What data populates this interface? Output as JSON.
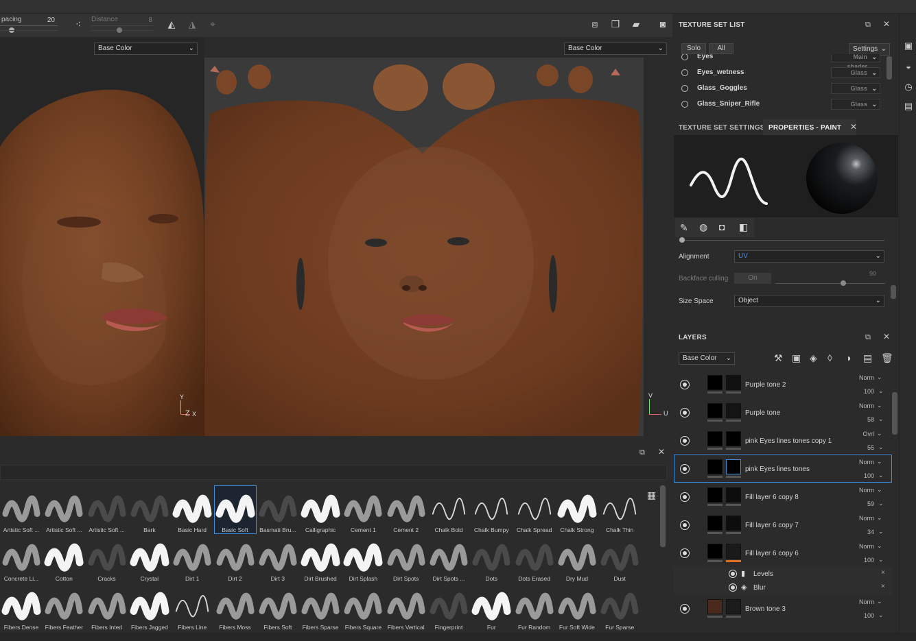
{
  "toolbar": {
    "spacing_label": "pacing",
    "spacing_value": "20",
    "distance_label": "Distance",
    "distance_value": "8",
    "spacing_slider": 0.2,
    "distance_slider": 0.45
  },
  "viewport3d": {
    "channel": "Base Color",
    "axis_y": "Y",
    "axis_z": "Z",
    "axis_x": "X"
  },
  "viewport2d": {
    "channel": "Base Color",
    "axis_v": "V",
    "axis_u": "U"
  },
  "texture_set_list": {
    "title": "TEXTURE SET LIST",
    "solo_label": "Solo",
    "all_label": "All",
    "settings_label": "Settings",
    "items": [
      {
        "name": "Eyes",
        "shader": "Main shader"
      },
      {
        "name": "Eyes_wetness",
        "shader": "Glass"
      },
      {
        "name": "Glass_Goggles",
        "shader": "Glass"
      },
      {
        "name": "Glass_Sniper_Rifle",
        "shader": "Glass"
      }
    ]
  },
  "properties": {
    "tab_settings": "TEXTURE SET SETTINGS",
    "tab_paint": "PROPERTIES - PAINT",
    "alignment_label": "Alignment",
    "alignment_value": "UV",
    "backface_label": "Backface culling",
    "backface_value": "On",
    "backface_number": "90",
    "backface_slider": 0.62,
    "size_space_label": "Size Space",
    "size_space_value": "Object"
  },
  "layers": {
    "title": "LAYERS",
    "channel": "Base Color",
    "rows": [
      {
        "name": "Purple tone 2",
        "blend": "Norm",
        "opacity": "100"
      },
      {
        "name": "Purple tone",
        "blend": "Norm",
        "opacity": "58"
      },
      {
        "name": "pink Eyes lines tones copy 1",
        "blend": "Ovrl",
        "opacity": "55"
      },
      {
        "name": "pink Eyes lines tones",
        "blend": "Norm",
        "opacity": "100"
      },
      {
        "name": "Fill layer 6 copy 8",
        "blend": "Norm",
        "opacity": "59"
      },
      {
        "name": "Fill layer 6 copy 7",
        "blend": "Norm",
        "opacity": "34"
      },
      {
        "name": "Fill layer 6 copy 6",
        "blend": "Norm",
        "opacity": "100"
      }
    ],
    "effects": [
      {
        "name": "Levels"
      },
      {
        "name": "Blur"
      }
    ],
    "last_row": {
      "name": "Brown tone 3",
      "blend": "Norm",
      "opacity": "100"
    }
  },
  "brushes": {
    "rows": [
      [
        "Artistic Soft ...",
        "Artistic Soft ...",
        "Artistic Soft ...",
        "Bark",
        "Basic Hard",
        "Basic Soft",
        "Basmati Bru...",
        "Calligraphic",
        "Cement 1",
        "Cement 2",
        "Chalk Bold",
        "Chalk Bumpy",
        "Chalk Spread",
        "Chalk Strong",
        "Chalk Thin"
      ],
      [
        "Concrete Li...",
        "Cotton",
        "Cracks",
        "Crystal",
        "Dirt 1",
        "Dirt 2",
        "Dirt 3",
        "Dirt Brushed",
        "Dirt Splash",
        "Dirt Spots",
        "Dirt Spots ...",
        "Dots",
        "Dots Erased",
        "Dry Mud",
        "Dust"
      ],
      [
        "Fibers Dense",
        "Fibers Feather",
        "Fibers Inted",
        "Fibers Jagged",
        "Fibers Line",
        "Fibers Moss",
        "Fibers Soft",
        "Fibers Sparse",
        "Fibers Square",
        "Fibers Vertical",
        "Fingerprint",
        "Fur",
        "Fur Random",
        "Fur Soft Wide",
        "Fur Sparse"
      ]
    ],
    "selected": "Basic Soft"
  },
  "colors": {
    "skin": "#7a4526",
    "accent": "#3d8ee0",
    "panel": "#2b2b2b"
  }
}
